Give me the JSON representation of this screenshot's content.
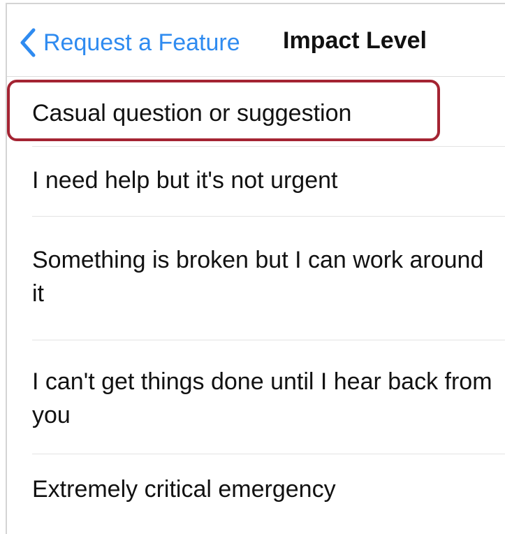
{
  "navbar": {
    "back_icon": "chevron-left-icon",
    "back_label": "Request a Feature",
    "title": "Impact Level"
  },
  "options": [
    {
      "label": "Casual question or suggestion",
      "highlighted": true
    },
    {
      "label": "I need help but it's not urgent",
      "highlighted": false
    },
    {
      "label": "Something is broken but I can work around it",
      "highlighted": false
    },
    {
      "label": "I can't get things done until I hear back from you",
      "highlighted": false
    },
    {
      "label": "Extremely critical emergency",
      "highlighted": false
    }
  ],
  "colors": {
    "accent": "#2f8bf0",
    "highlight_border": "#a42433",
    "text": "#111111",
    "separator": "#e3e3e3"
  }
}
